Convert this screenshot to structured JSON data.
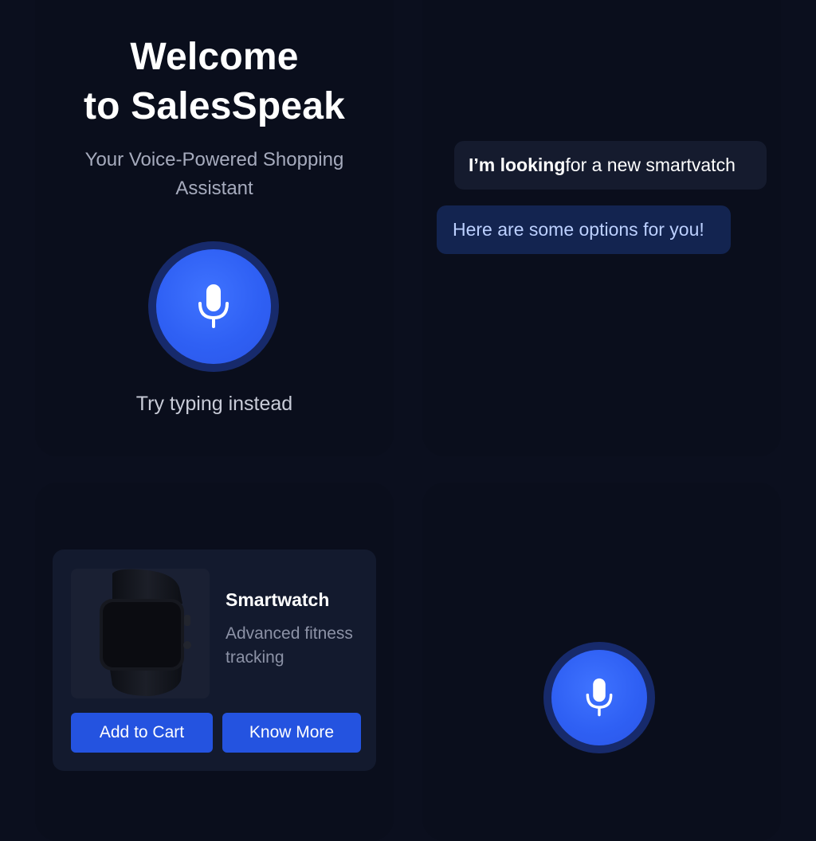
{
  "welcome": {
    "title_line1": "Welcome",
    "title_line2": "to SalesSpeak",
    "subtitle": "Your Voice-Powered Shopping Assistant",
    "try_typing": "Try typing instead"
  },
  "chat": {
    "user_message_bold": "I’m looking",
    "user_message_rest": " for a new smartvatch",
    "bot_message": "Here are some options for you!"
  },
  "product": {
    "name": "Smartwatch",
    "description": "Advanced fitness tracking",
    "add_to_cart_label": "Add to Cart",
    "know_more_label": "Know More"
  },
  "icons": {
    "mic": "microphone-icon",
    "product_image": "smartwatch-image"
  },
  "colors": {
    "background": "#0b0f1e",
    "panel": "#0a0e1c",
    "accent": "#2f60f4",
    "button": "#2453e0",
    "bot_bubble": "#132450"
  }
}
